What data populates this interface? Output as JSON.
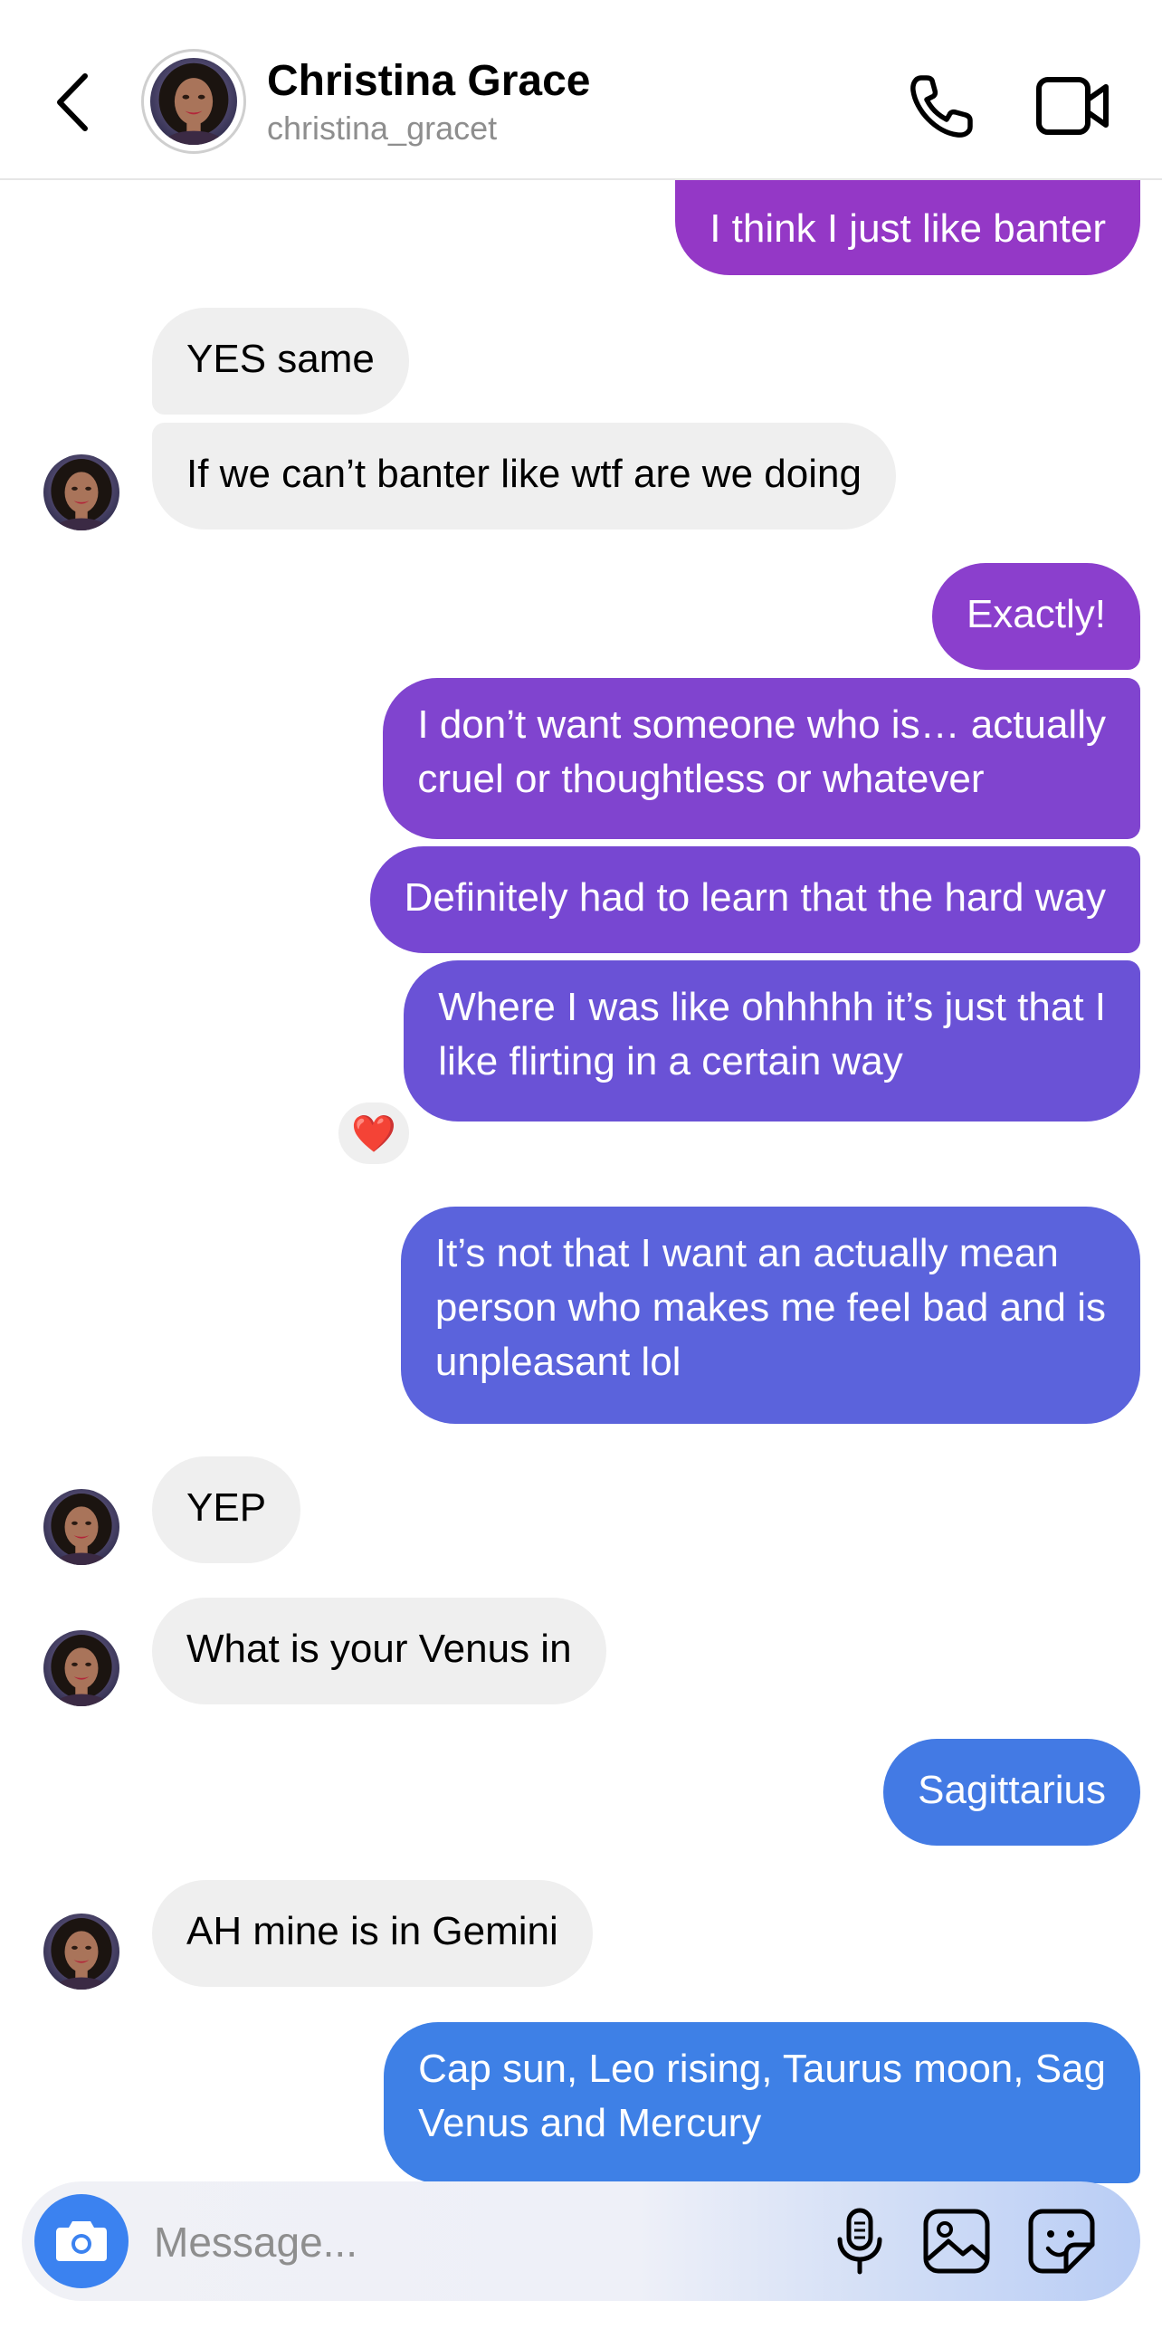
{
  "header": {
    "contact_name": "Christina Grace",
    "contact_handle": "christina_gracet",
    "back_icon": "chevron-left-icon",
    "call_icon": "phone-icon",
    "video_icon": "video-camera-icon"
  },
  "messages": [
    {
      "from": "me",
      "text": "I think I just like banter",
      "color": "#9438c6"
    },
    {
      "from": "them",
      "text": "YES same"
    },
    {
      "from": "them",
      "text": "If we can’t banter like wtf are we doing"
    },
    {
      "from": "me",
      "text": "Exactly!",
      "color": "#8b3fcd"
    },
    {
      "from": "me",
      "text_lines": [
        "I don’t want someone who is… actually",
        "cruel or thoughtless or whatever"
      ],
      "color": "#8044cf"
    },
    {
      "from": "me",
      "text": "Definitely had to learn that the hard way",
      "color": "#7747d2"
    },
    {
      "from": "me",
      "text_lines": [
        "Where I was like ohhhhh it’s just that I",
        "like flirting in a certain way"
      ],
      "color": "#6a52d6",
      "reaction": "❤️"
    },
    {
      "from": "me",
      "text_lines": [
        "It’s not that I want an actually mean",
        "person who makes me feel bad and is",
        "unpleasant lol"
      ],
      "color": "#5b63dc"
    },
    {
      "from": "them",
      "text": "YEP"
    },
    {
      "from": "them",
      "text": "What is your Venus in"
    },
    {
      "from": "me",
      "text": "Sagittarius",
      "color": "#437ae4"
    },
    {
      "from": "them",
      "text": "AH mine is in Gemini"
    },
    {
      "from": "me",
      "text_lines": [
        "Cap sun, Leo rising, Taurus moon, Sag",
        "Venus and Mercury"
      ],
      "color": "#3e80e6"
    }
  ],
  "composer": {
    "placeholder": "Message...",
    "camera_icon": "camera-icon",
    "mic_icon": "microphone-icon",
    "gallery_icon": "image-gallery-icon",
    "sticker_icon": "sticker-icon"
  },
  "colors": {
    "incoming_bubble": "#efefef",
    "camera_button": "#3b82f0",
    "handle_text": "#8e8e8e"
  }
}
